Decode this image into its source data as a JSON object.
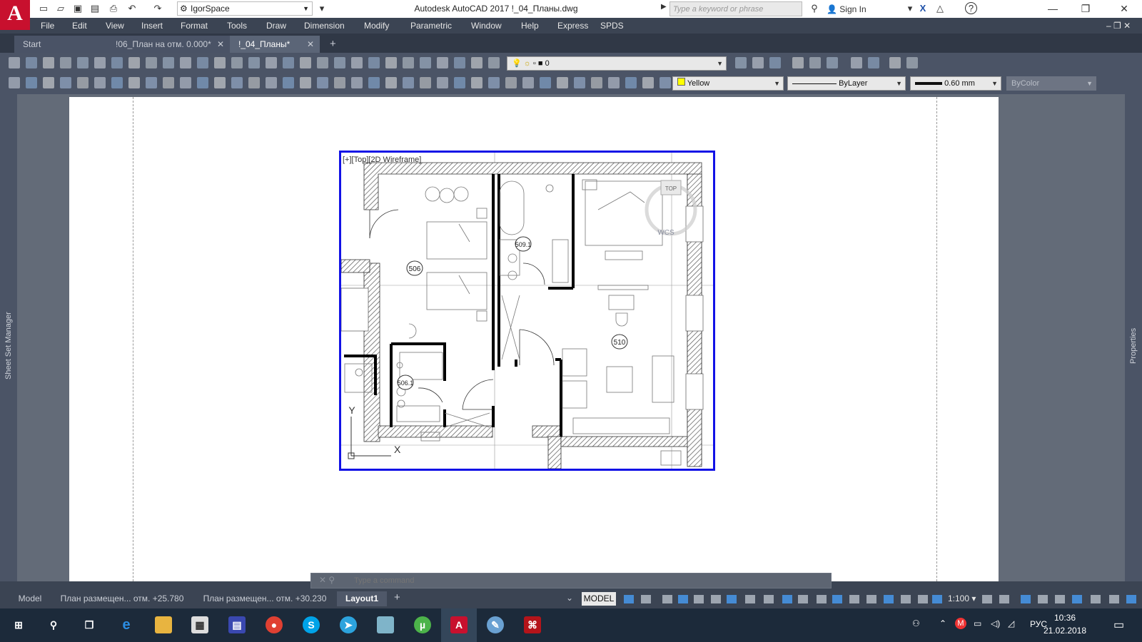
{
  "titlebar": {
    "logo_letter": "A",
    "workspace": "IgorSpace",
    "title": "Autodesk AutoCAD 2017    !_04_Планы.dwg",
    "search_placeholder": "Type a keyword or phrase",
    "signin_label": "Sign In"
  },
  "menu": [
    "File",
    "Edit",
    "View",
    "Insert",
    "Format",
    "Tools",
    "Draw",
    "Dimension",
    "Modify",
    "Parametric",
    "Window",
    "Help",
    "Express",
    "SPDS"
  ],
  "tabs": [
    {
      "label": "Start"
    },
    {
      "label": "!06_План на отм. 0.000*"
    },
    {
      "label": "!_04_Планы*"
    }
  ],
  "toolbar": {
    "layer_name": "0",
    "color": "Yellow",
    "linetype": "ByLayer",
    "lineweight": "0.60 mm",
    "plotstyle": "ByColor"
  },
  "palettes": {
    "left": "Sheet Set Manager",
    "right": "Properties"
  },
  "viewport": {
    "label": "[+][Top][2D Wireframe]",
    "viewcube_top": "TOP",
    "wcs": "WCS",
    "rooms": [
      "506",
      "510",
      "509.1",
      "506.1"
    ]
  },
  "cmdline_placeholder": "Type a command",
  "layout_tabs": [
    {
      "label": "Model"
    },
    {
      "label": "План размещен... отм. +25.780"
    },
    {
      "label": "План размещен... отм. +30.230"
    },
    {
      "label": "Layout1"
    }
  ],
  "status": {
    "model": "MODEL",
    "scale": "1:100"
  },
  "taskbar": {
    "lang": "РУС",
    "time": "10:36",
    "date": "21.02.2018"
  },
  "colors": {
    "app_red": "#c8102e",
    "viewport_border": "#1212e6",
    "ui_dark": "#3b4453"
  }
}
